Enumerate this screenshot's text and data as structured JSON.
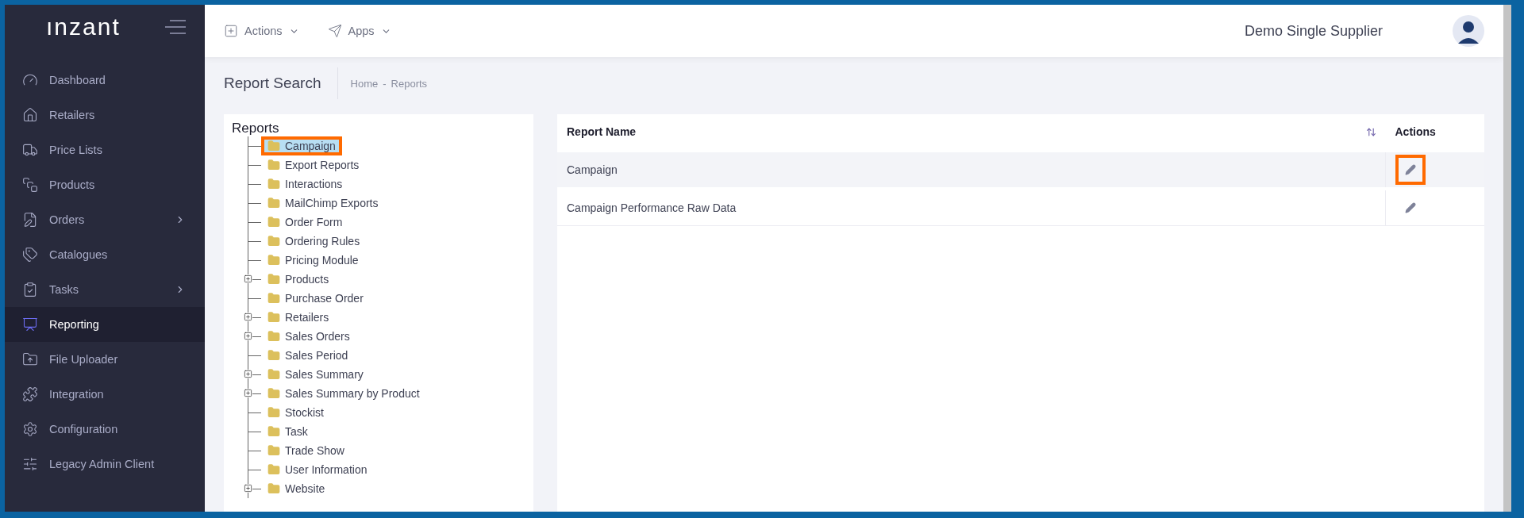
{
  "sidebar": {
    "logo": "ınzant",
    "items": [
      {
        "label": "Dashboard",
        "selected": false,
        "has_submenu": false
      },
      {
        "label": "Retailers",
        "selected": false,
        "has_submenu": false
      },
      {
        "label": "Price Lists",
        "selected": false,
        "has_submenu": false
      },
      {
        "label": "Products",
        "selected": false,
        "has_submenu": false
      },
      {
        "label": "Orders",
        "selected": false,
        "has_submenu": true
      },
      {
        "label": "Catalogues",
        "selected": false,
        "has_submenu": false
      },
      {
        "label": "Tasks",
        "selected": false,
        "has_submenu": true
      },
      {
        "label": "Reporting",
        "selected": true,
        "has_submenu": false
      },
      {
        "label": "File Uploader",
        "selected": false,
        "has_submenu": false
      },
      {
        "label": "Integration",
        "selected": false,
        "has_submenu": false
      },
      {
        "label": "Configuration",
        "selected": false,
        "has_submenu": false
      },
      {
        "label": "Legacy Admin Client",
        "selected": false,
        "has_submenu": false
      }
    ]
  },
  "topbar": {
    "menus": [
      {
        "label": "Actions"
      },
      {
        "label": "Apps"
      }
    ],
    "user_name": "Demo Single Supplier"
  },
  "page": {
    "title": "Report Search",
    "breadcrumb": {
      "items": [
        "Home",
        "Reports"
      ],
      "separator": "-"
    }
  },
  "tree": {
    "title": "Reports",
    "items": [
      {
        "label": "Campaign",
        "selected": true,
        "expandable": false,
        "highlighted": true
      },
      {
        "label": "Export Reports",
        "selected": false,
        "expandable": false,
        "highlighted": false
      },
      {
        "label": "Interactions",
        "selected": false,
        "expandable": false,
        "highlighted": false
      },
      {
        "label": "MailChimp Exports",
        "selected": false,
        "expandable": false,
        "highlighted": false
      },
      {
        "label": "Order Form",
        "selected": false,
        "expandable": false,
        "highlighted": false
      },
      {
        "label": "Ordering Rules",
        "selected": false,
        "expandable": false,
        "highlighted": false
      },
      {
        "label": "Pricing Module",
        "selected": false,
        "expandable": false,
        "highlighted": false
      },
      {
        "label": "Products",
        "selected": false,
        "expandable": true,
        "highlighted": false
      },
      {
        "label": "Purchase Order",
        "selected": false,
        "expandable": false,
        "highlighted": false
      },
      {
        "label": "Retailers",
        "selected": false,
        "expandable": true,
        "highlighted": false
      },
      {
        "label": "Sales Orders",
        "selected": false,
        "expandable": true,
        "highlighted": false
      },
      {
        "label": "Sales Period",
        "selected": false,
        "expandable": false,
        "highlighted": false
      },
      {
        "label": "Sales Summary",
        "selected": false,
        "expandable": true,
        "highlighted": false
      },
      {
        "label": "Sales Summary by Product",
        "selected": false,
        "expandable": true,
        "highlighted": false
      },
      {
        "label": "Stockist",
        "selected": false,
        "expandable": false,
        "highlighted": false
      },
      {
        "label": "Task",
        "selected": false,
        "expandable": false,
        "highlighted": false
      },
      {
        "label": "Trade Show",
        "selected": false,
        "expandable": false,
        "highlighted": false
      },
      {
        "label": "User Information",
        "selected": false,
        "expandable": false,
        "highlighted": false
      },
      {
        "label": "Website",
        "selected": false,
        "expandable": true,
        "highlighted": false
      }
    ]
  },
  "table": {
    "columns": [
      {
        "label": "Report Name",
        "sortable": true
      },
      {
        "label": "Actions",
        "sortable": false
      }
    ],
    "rows": [
      {
        "name": "Campaign",
        "selected": true,
        "highlighted": true
      },
      {
        "name": "Campaign Performance Raw Data",
        "selected": false,
        "highlighted": false
      }
    ]
  }
}
